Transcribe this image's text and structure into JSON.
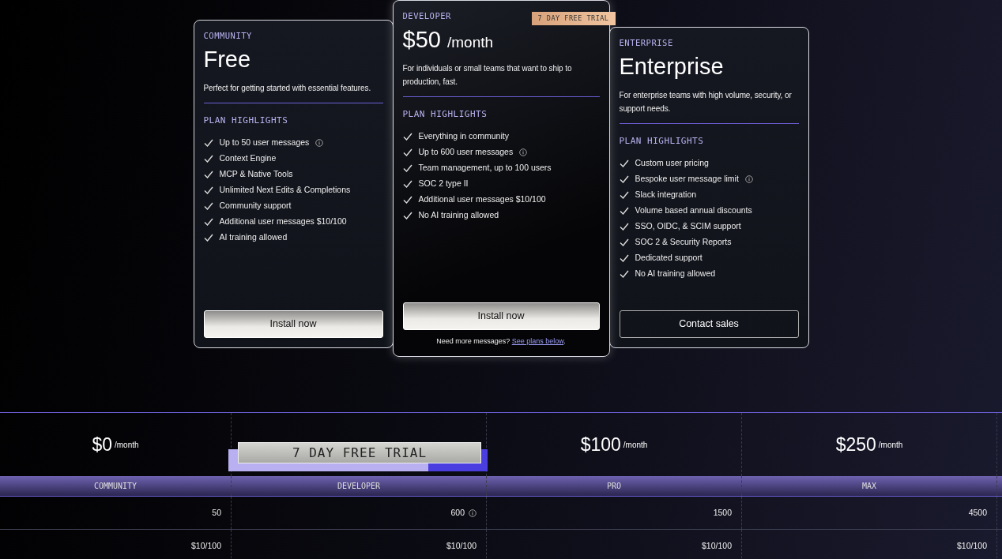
{
  "plans": [
    {
      "tier": "COMMUNITY",
      "title": "Free",
      "description": "Perfect for getting started with essential features.",
      "highlights_label": "PLAN HIGHLIGHTS",
      "features": [
        {
          "text": "Up to 50 user messages",
          "info": true
        },
        {
          "text": "Context Engine",
          "info": false
        },
        {
          "text": "MCP & Native Tools",
          "info": false
        },
        {
          "text": "Unlimited Next Edits & Completions",
          "info": false
        },
        {
          "text": "Community support",
          "info": false
        },
        {
          "text": "Additional user messages $10/100",
          "info": false
        },
        {
          "text": "AI training allowed",
          "info": false
        }
      ],
      "button": {
        "label": "Install now",
        "kind": "primary"
      }
    },
    {
      "tier": "DEVELOPER",
      "price": "$50",
      "per": "/month",
      "badge": "7 DAY FREE TRIAL",
      "description": "For individuals or small teams that want to ship to production, fast.",
      "highlights_label": "PLAN HIGHLIGHTS",
      "features": [
        {
          "text": "Everything in community",
          "info": false
        },
        {
          "text": "Up to 600 user messages",
          "info": true
        },
        {
          "text": "Team management, up to 100 users",
          "info": false
        },
        {
          "text": "SOC 2 type II",
          "info": false
        },
        {
          "text": "Additional user messages $10/100",
          "info": false
        },
        {
          "text": "No AI training allowed",
          "info": false
        }
      ],
      "button": {
        "label": "Install now",
        "kind": "primary"
      },
      "note": {
        "text": "Need more messages?",
        "link": "See plans below",
        "after": "."
      }
    },
    {
      "tier": "ENTERPRISE",
      "title": "Enterprise",
      "description": "For enterprise teams with high volume, security, or support needs.",
      "highlights_label": "PLAN HIGHLIGHTS",
      "features": [
        {
          "text": "Custom user pricing",
          "info": false
        },
        {
          "text": "Bespoke user message limit",
          "info": true
        },
        {
          "text": "Slack integration",
          "info": false
        },
        {
          "text": "Volume based annual discounts",
          "info": false
        },
        {
          "text": "SSO, OIDC, & SCIM support",
          "info": false
        },
        {
          "text": "SOC 2 & Security Reports",
          "info": false
        },
        {
          "text": "Dedicated support",
          "info": false
        },
        {
          "text": "No AI training allowed",
          "info": false
        }
      ],
      "button": {
        "label": "Contact sales",
        "kind": "outline"
      }
    }
  ],
  "comparison": {
    "trial_banner": "7 DAY FREE TRIAL",
    "columns": [
      {
        "price": "$0",
        "per": "/month",
        "name": "COMMUNITY",
        "trial": false
      },
      {
        "name": "DEVELOPER",
        "trial": true
      },
      {
        "price": "$100",
        "per": "/month",
        "name": "PRO",
        "trial": false
      },
      {
        "price": "$250",
        "per": "/month",
        "name": "MAX",
        "trial": false
      }
    ],
    "rows": [
      [
        {
          "text": "50",
          "info": false
        },
        {
          "text": "600",
          "info": true
        },
        {
          "text": "1500",
          "info": false
        },
        {
          "text": "4500",
          "info": false
        }
      ],
      [
        {
          "text": "$10/100",
          "info": false
        },
        {
          "text": "$10/100",
          "info": false
        },
        {
          "text": "$10/100",
          "info": false
        },
        {
          "text": "$10/100",
          "info": false
        }
      ]
    ]
  }
}
